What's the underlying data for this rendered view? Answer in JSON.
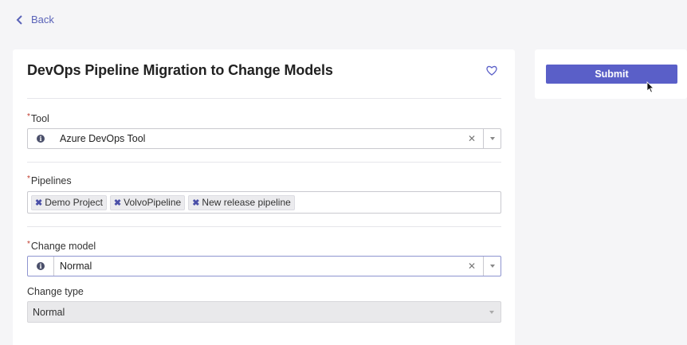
{
  "nav": {
    "back_label": "Back"
  },
  "form": {
    "title": "DevOps Pipeline Migration to Change Models",
    "tool": {
      "label": "Tool",
      "value": "Azure DevOps Tool"
    },
    "pipelines": {
      "label": "Pipelines",
      "tags": [
        "Demo Project",
        "VolvoPipeline",
        "New release pipeline"
      ]
    },
    "change_model": {
      "label": "Change model",
      "value": "Normal"
    },
    "change_type": {
      "label": "Change type",
      "value": "Normal"
    }
  },
  "actions": {
    "submit_label": "Submit"
  },
  "icons": {
    "back": "chevron-left-icon",
    "favorite": "heart-icon",
    "info": "info-icon",
    "clear": "clear-icon",
    "dropdown": "chevron-down-icon",
    "tag_remove": "close-icon",
    "cursor": "mouse-pointer-icon"
  },
  "colors": {
    "accent": "#5a5fc8",
    "link": "#5a63b8",
    "required": "#c0392b",
    "background": "#f5f5f7"
  }
}
